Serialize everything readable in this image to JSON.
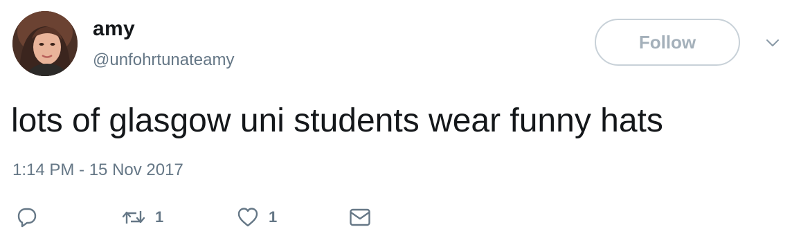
{
  "user": {
    "display_name": "amy",
    "handle": "@unfohrtunateamy",
    "avatar_icon": "profile-photo"
  },
  "follow_button": {
    "label": "Follow",
    "border_color": "#c8d1d8",
    "text_color": "#a4b0ba"
  },
  "menu": {
    "icon": "chevron-down-icon"
  },
  "tweet": {
    "text": "lots of glasgow uni students wear funny hats",
    "timestamp": "1:14 PM - 15 Nov 2017"
  },
  "actions": {
    "reply": {
      "icon": "reply-icon"
    },
    "retweet": {
      "icon": "retweet-icon",
      "count": "1"
    },
    "like": {
      "icon": "heart-icon",
      "count": "1"
    },
    "message": {
      "icon": "envelope-icon"
    }
  },
  "colors": {
    "text_primary": "#14171a",
    "text_secondary": "#657786"
  }
}
